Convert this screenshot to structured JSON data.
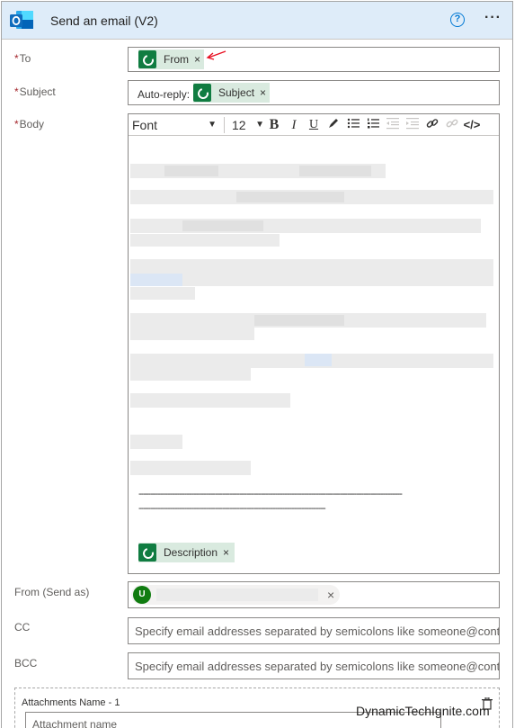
{
  "header": {
    "title": "Send an email (V2)",
    "help_label": "?",
    "more_label": "···"
  },
  "fields": {
    "to": {
      "label": "To",
      "token": "From",
      "token_remove": "×"
    },
    "subject": {
      "label": "Subject",
      "prefix": "Auto-reply:",
      "token": "Subject",
      "token_remove": "×"
    },
    "body": {
      "label": "Body",
      "toolbar": {
        "font": "Font",
        "size": "12",
        "bold": "B",
        "italic": "I",
        "underline": "U",
        "code": "</>"
      },
      "divider_line_1": "--------------------------------------------------------------------------------------------------------------",
      "divider_line_2": "------------------------------------------------------------------------------",
      "token": "Description",
      "token_remove": "×"
    },
    "from_send_as": {
      "label": "From (Send as)",
      "avatar_letter": "U",
      "remove": "×"
    },
    "cc": {
      "label": "CC",
      "placeholder": "Specify email addresses separated by semicolons like someone@contoso.com"
    },
    "bcc": {
      "label": "BCC",
      "placeholder": "Specify email addresses separated by semicolons like someone@contoso.com"
    },
    "attachments": {
      "label": "Attachments Name - 1",
      "name_placeholder": "Attachment name"
    }
  },
  "watermark": "DynamicTechIgnite.com",
  "colors": {
    "header_bg": "#deecf9",
    "token_bg": "#d9eadf",
    "token_icon": "#107c41",
    "required": "#a4262c",
    "accent": "#0078d4"
  }
}
